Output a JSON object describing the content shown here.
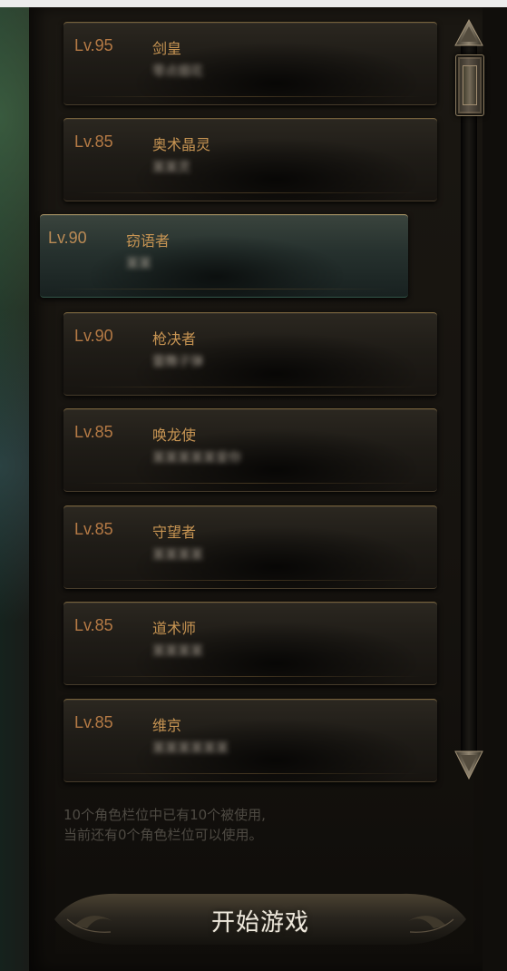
{
  "characters": [
    {
      "level": "Lv.95",
      "class": "剑皇",
      "name": "零点烟花"
    },
    {
      "level": "Lv.85",
      "class": "奥术晶灵",
      "name": "某某灵"
    },
    {
      "level": "Lv.90",
      "class": "窃语者",
      "name": "某某"
    },
    {
      "level": "Lv.90",
      "class": "枪决者",
      "name": "雷舞子弹"
    },
    {
      "level": "Lv.85",
      "class": "唤龙使",
      "name": "某某某某某爱你"
    },
    {
      "level": "Lv.85",
      "class": "守望者",
      "name": "某某某某"
    },
    {
      "level": "Lv.85",
      "class": "道术师",
      "name": "某某某某"
    },
    {
      "level": "Lv.85",
      "class": "维京",
      "name": "某某某某某某"
    }
  ],
  "selected_index": 2,
  "slot_info": {
    "line1": "10个角色栏位中已有10个被使用,",
    "line2": "当前还有0个角色栏位可以使用。"
  },
  "start_button": {
    "label": "开始游戏"
  },
  "scrollbar": {
    "up_icon": "arrow-up-icon",
    "down_icon": "arrow-down-icon"
  },
  "colors": {
    "level_text": "#b57a45",
    "class_text": "#c89553",
    "selected_card": "#2f3a36",
    "button_text": "#eee8dc"
  }
}
